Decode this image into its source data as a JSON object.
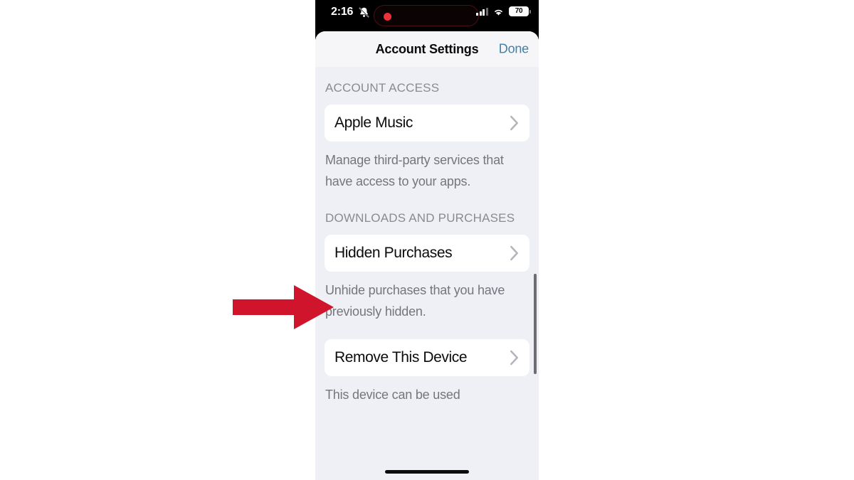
{
  "status_bar": {
    "time": "2:16",
    "silent_icon": "bell-slash-icon",
    "recording_indicator": "record-dot-icon",
    "cellular_icon": "cellular-signal-icon",
    "wifi_icon": "wifi-icon",
    "battery_level": "70"
  },
  "sheet": {
    "title": "Account Settings",
    "done_label": "Done",
    "done_color": "#3e81a9"
  },
  "sections": [
    {
      "header": "ACCOUNT ACCESS",
      "row_label": "Apple Music",
      "footnote": "Manage third-party services that have access to your apps."
    },
    {
      "header": "DOWNLOADS AND PURCHASES",
      "row_label": "Hidden Purchases",
      "footnote": "Unhide purchases that you have previously hidden."
    },
    {
      "header": "",
      "row_label": "Remove This Device",
      "footnote": "This device can be used"
    }
  ],
  "annotation": {
    "name": "red-arrow",
    "points_at": "Hidden Purchases",
    "color": "#d0142c"
  }
}
